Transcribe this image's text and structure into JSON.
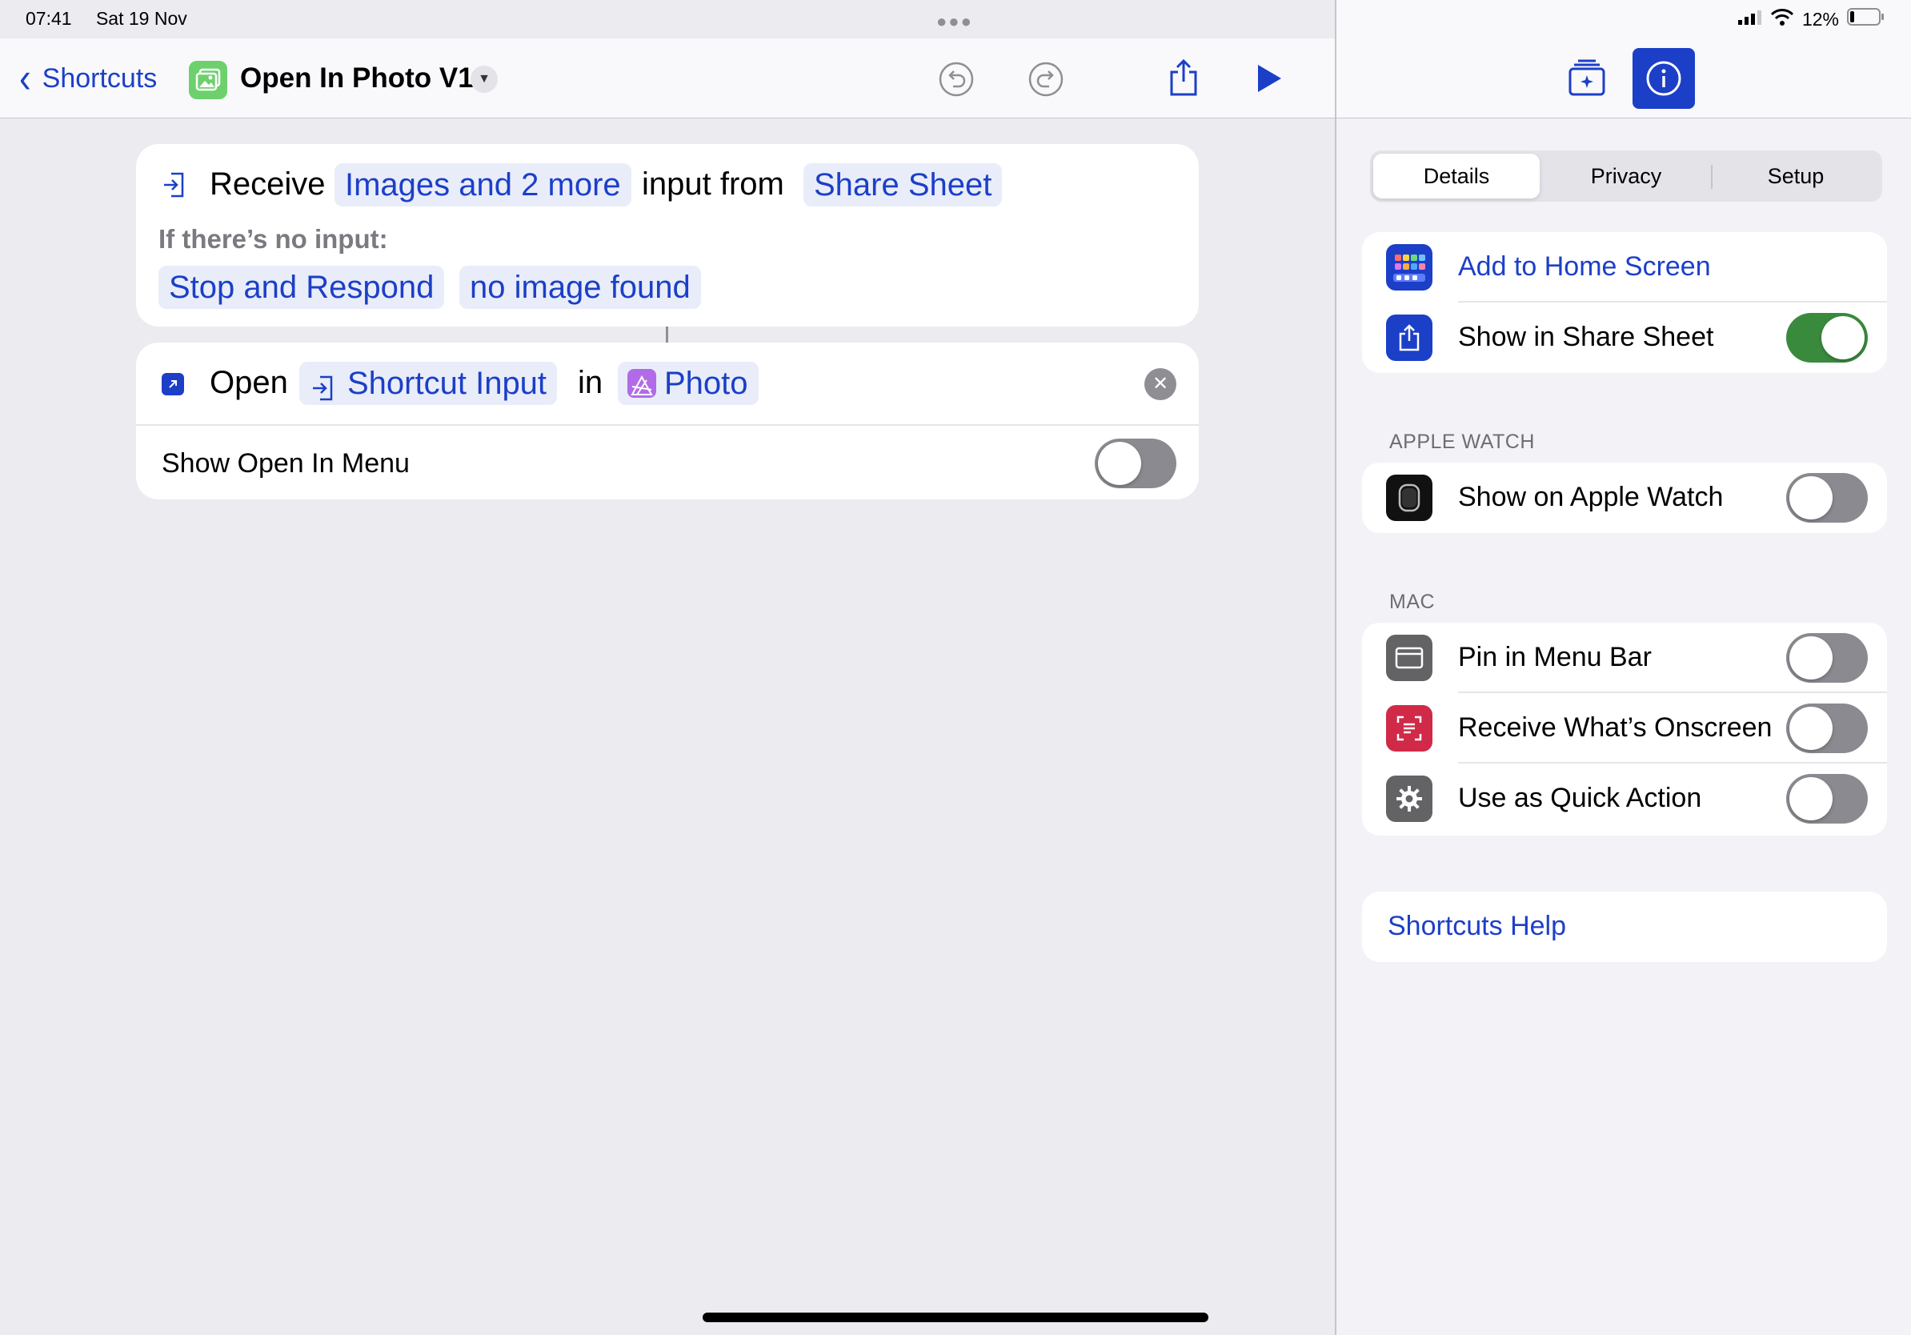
{
  "status_bar": {
    "time": "07:41",
    "date": "Sat 19 Nov",
    "battery": "12%"
  },
  "nav": {
    "back_label": "Shortcuts",
    "title": "Open In Photo V1"
  },
  "receive_action": {
    "verb": "Receive",
    "input_types": "Images and 2 more",
    "connector": "input from",
    "source": "Share Sheet",
    "no_input_label": "If there’s no input:",
    "no_input_action": "Stop and Respond",
    "no_input_message": "no image found"
  },
  "open_action": {
    "verb": "Open",
    "input": "Shortcut Input",
    "connector": "in",
    "app": "Photo",
    "option_label": "Show Open In Menu",
    "option_enabled": false
  },
  "panel": {
    "tabs": [
      "Details",
      "Privacy",
      "Setup"
    ],
    "active_tab": "Details",
    "general": [
      {
        "label": "Add to Home Screen",
        "icon": "home-screen-icon",
        "action": true
      },
      {
        "label": "Show in Share Sheet",
        "icon": "share-icon",
        "enabled": true
      }
    ],
    "apple_watch_header": "APPLE WATCH",
    "apple_watch": [
      {
        "label": "Show on Apple Watch",
        "icon": "apple-watch-icon",
        "enabled": false
      }
    ],
    "mac_header": "MAC",
    "mac": [
      {
        "label": "Pin in Menu Bar",
        "icon": "menu-bar-icon",
        "enabled": false
      },
      {
        "label": "Receive What’s Onscreen",
        "icon": "onscreen-icon",
        "enabled": false
      },
      {
        "label": "Use as Quick Action",
        "icon": "gear-icon",
        "enabled": false
      }
    ],
    "help_label": "Shortcuts Help"
  },
  "colors": {
    "accent": "#1c3fc8",
    "toggle_on": "#3a8a3e",
    "toggle_off": "#8a8a90",
    "pill_bg": "#e9edf9"
  }
}
